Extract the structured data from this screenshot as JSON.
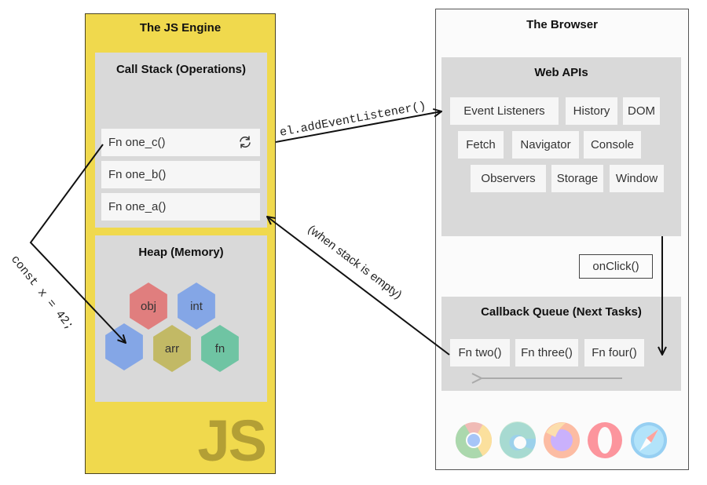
{
  "engine": {
    "title": "The JS Engine",
    "logo_text": "JS",
    "background": "#f0d94d",
    "call_stack": {
      "title": "Call Stack (Operations)",
      "items": [
        {
          "label": "Fn one_c()",
          "icon": "refresh-icon"
        },
        {
          "label": "Fn one_b()"
        },
        {
          "label": "Fn one_a()"
        }
      ]
    },
    "heap": {
      "title": "Heap (Memory)",
      "cells": [
        {
          "label": "obj",
          "color": "#e07e7e"
        },
        {
          "label": "int",
          "color": "#84a6e6"
        },
        {
          "label": "",
          "color": "#84a6e6"
        },
        {
          "label": "arr",
          "color": "#c2b965"
        },
        {
          "label": "fn",
          "color": "#6fc4a3"
        }
      ]
    }
  },
  "browser": {
    "title": "The Browser",
    "web_apis": {
      "title": "Web APIs",
      "rows": [
        [
          "Event Listeners",
          "History",
          "DOM"
        ],
        [
          "Fetch",
          "Navigator",
          "Console"
        ],
        [
          "Observers",
          "Storage",
          "Window"
        ]
      ]
    },
    "pending_callback": "onClick()",
    "callback_queue": {
      "title": "Callback Queue (Next Tasks)",
      "items": [
        "Fn two()",
        "Fn three()",
        "Fn four()"
      ]
    },
    "browser_icons": [
      "chrome-icon",
      "edge-icon",
      "firefox-icon",
      "opera-icon",
      "safari-icon"
    ]
  },
  "annotations": {
    "register_listener": "el.addEventListener()",
    "event_loop": "(when stack is empty)",
    "heap_alloc": "const x = 42;"
  }
}
